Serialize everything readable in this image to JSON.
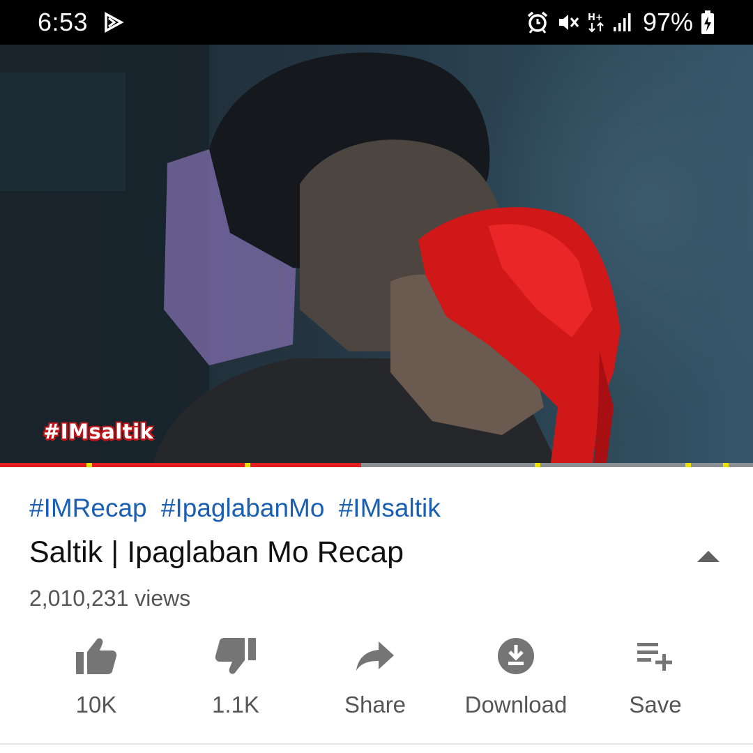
{
  "status_bar": {
    "time": "6:53",
    "battery": "97%",
    "icons": [
      "play-store-notification-icon",
      "alarm-icon",
      "mute-icon",
      "data-hplus-icon",
      "signal-icon",
      "battery-charging-icon"
    ]
  },
  "video": {
    "overlay_hashtag": "#IMsaltik",
    "progress": 0.48,
    "chapter_markers": [
      0.115,
      0.325,
      0.71,
      0.91,
      0.96
    ]
  },
  "info": {
    "hashtags": [
      "#IMRecap",
      "#IpaglabanMo",
      "#IMsaltik"
    ],
    "title": "Saltik | Ipaglaban Mo Recap",
    "views": "2,010,231 views"
  },
  "actions": [
    {
      "icon": "thumbs-up-icon",
      "label": "10K"
    },
    {
      "icon": "thumbs-down-icon",
      "label": "1.1K"
    },
    {
      "icon": "share-icon",
      "label": "Share"
    },
    {
      "icon": "download-icon",
      "label": "Download"
    },
    {
      "icon": "save-playlist-icon",
      "label": "Save"
    }
  ],
  "colors": {
    "hashtag": "#1a5fb4",
    "progress_fill": "#e11d1d",
    "icon_gray": "#757575"
  }
}
